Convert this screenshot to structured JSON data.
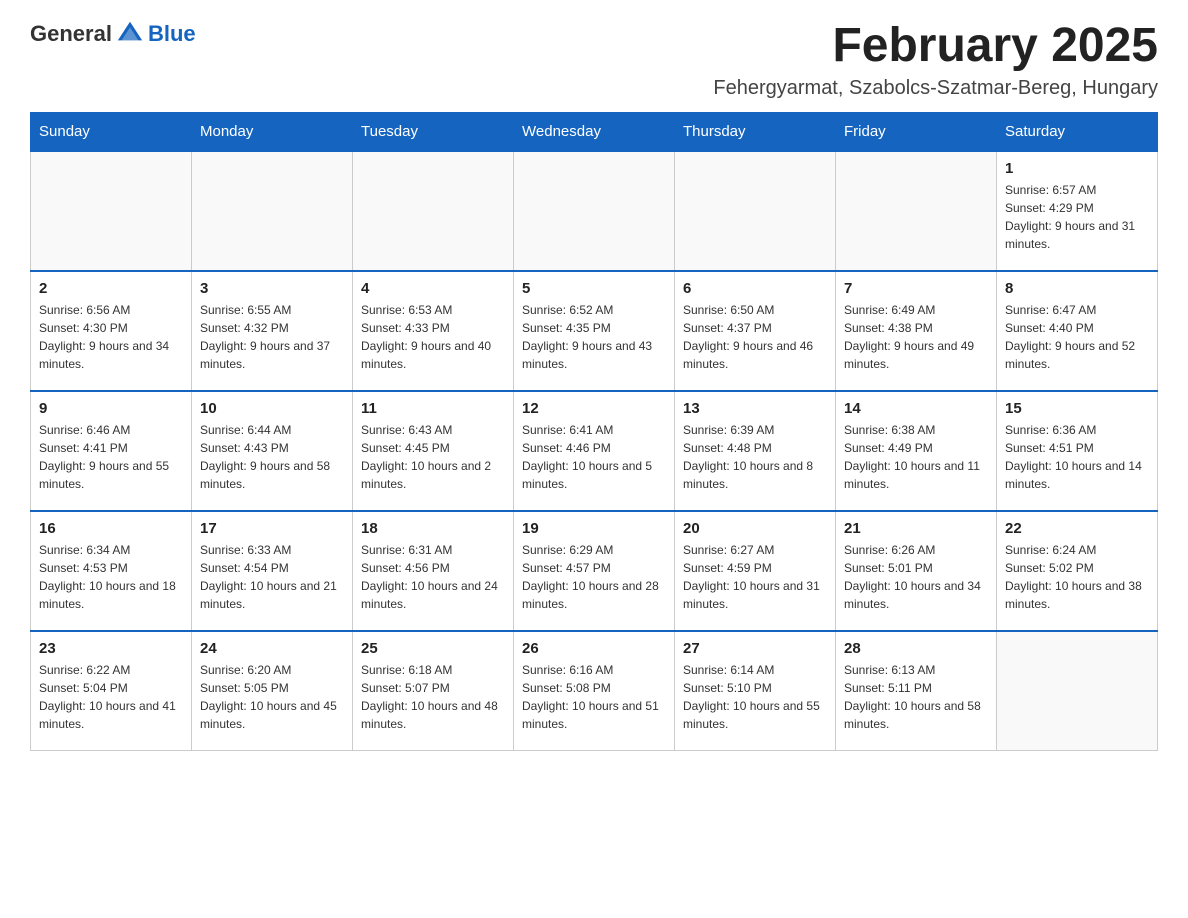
{
  "logo": {
    "text_general": "General",
    "text_blue": "Blue"
  },
  "header": {
    "month_title": "February 2025",
    "location": "Fehergyarmat, Szabolcs-Szatmar-Bereg, Hungary"
  },
  "weekdays": [
    "Sunday",
    "Monday",
    "Tuesday",
    "Wednesday",
    "Thursday",
    "Friday",
    "Saturday"
  ],
  "rows": [
    [
      {
        "day": "",
        "sunrise": "",
        "sunset": "",
        "daylight": ""
      },
      {
        "day": "",
        "sunrise": "",
        "sunset": "",
        "daylight": ""
      },
      {
        "day": "",
        "sunrise": "",
        "sunset": "",
        "daylight": ""
      },
      {
        "day": "",
        "sunrise": "",
        "sunset": "",
        "daylight": ""
      },
      {
        "day": "",
        "sunrise": "",
        "sunset": "",
        "daylight": ""
      },
      {
        "day": "",
        "sunrise": "",
        "sunset": "",
        "daylight": ""
      },
      {
        "day": "1",
        "sunrise": "Sunrise: 6:57 AM",
        "sunset": "Sunset: 4:29 PM",
        "daylight": "Daylight: 9 hours and 31 minutes."
      }
    ],
    [
      {
        "day": "2",
        "sunrise": "Sunrise: 6:56 AM",
        "sunset": "Sunset: 4:30 PM",
        "daylight": "Daylight: 9 hours and 34 minutes."
      },
      {
        "day": "3",
        "sunrise": "Sunrise: 6:55 AM",
        "sunset": "Sunset: 4:32 PM",
        "daylight": "Daylight: 9 hours and 37 minutes."
      },
      {
        "day": "4",
        "sunrise": "Sunrise: 6:53 AM",
        "sunset": "Sunset: 4:33 PM",
        "daylight": "Daylight: 9 hours and 40 minutes."
      },
      {
        "day": "5",
        "sunrise": "Sunrise: 6:52 AM",
        "sunset": "Sunset: 4:35 PM",
        "daylight": "Daylight: 9 hours and 43 minutes."
      },
      {
        "day": "6",
        "sunrise": "Sunrise: 6:50 AM",
        "sunset": "Sunset: 4:37 PM",
        "daylight": "Daylight: 9 hours and 46 minutes."
      },
      {
        "day": "7",
        "sunrise": "Sunrise: 6:49 AM",
        "sunset": "Sunset: 4:38 PM",
        "daylight": "Daylight: 9 hours and 49 minutes."
      },
      {
        "day": "8",
        "sunrise": "Sunrise: 6:47 AM",
        "sunset": "Sunset: 4:40 PM",
        "daylight": "Daylight: 9 hours and 52 minutes."
      }
    ],
    [
      {
        "day": "9",
        "sunrise": "Sunrise: 6:46 AM",
        "sunset": "Sunset: 4:41 PM",
        "daylight": "Daylight: 9 hours and 55 minutes."
      },
      {
        "day": "10",
        "sunrise": "Sunrise: 6:44 AM",
        "sunset": "Sunset: 4:43 PM",
        "daylight": "Daylight: 9 hours and 58 minutes."
      },
      {
        "day": "11",
        "sunrise": "Sunrise: 6:43 AM",
        "sunset": "Sunset: 4:45 PM",
        "daylight": "Daylight: 10 hours and 2 minutes."
      },
      {
        "day": "12",
        "sunrise": "Sunrise: 6:41 AM",
        "sunset": "Sunset: 4:46 PM",
        "daylight": "Daylight: 10 hours and 5 minutes."
      },
      {
        "day": "13",
        "sunrise": "Sunrise: 6:39 AM",
        "sunset": "Sunset: 4:48 PM",
        "daylight": "Daylight: 10 hours and 8 minutes."
      },
      {
        "day": "14",
        "sunrise": "Sunrise: 6:38 AM",
        "sunset": "Sunset: 4:49 PM",
        "daylight": "Daylight: 10 hours and 11 minutes."
      },
      {
        "day": "15",
        "sunrise": "Sunrise: 6:36 AM",
        "sunset": "Sunset: 4:51 PM",
        "daylight": "Daylight: 10 hours and 14 minutes."
      }
    ],
    [
      {
        "day": "16",
        "sunrise": "Sunrise: 6:34 AM",
        "sunset": "Sunset: 4:53 PM",
        "daylight": "Daylight: 10 hours and 18 minutes."
      },
      {
        "day": "17",
        "sunrise": "Sunrise: 6:33 AM",
        "sunset": "Sunset: 4:54 PM",
        "daylight": "Daylight: 10 hours and 21 minutes."
      },
      {
        "day": "18",
        "sunrise": "Sunrise: 6:31 AM",
        "sunset": "Sunset: 4:56 PM",
        "daylight": "Daylight: 10 hours and 24 minutes."
      },
      {
        "day": "19",
        "sunrise": "Sunrise: 6:29 AM",
        "sunset": "Sunset: 4:57 PM",
        "daylight": "Daylight: 10 hours and 28 minutes."
      },
      {
        "day": "20",
        "sunrise": "Sunrise: 6:27 AM",
        "sunset": "Sunset: 4:59 PM",
        "daylight": "Daylight: 10 hours and 31 minutes."
      },
      {
        "day": "21",
        "sunrise": "Sunrise: 6:26 AM",
        "sunset": "Sunset: 5:01 PM",
        "daylight": "Daylight: 10 hours and 34 minutes."
      },
      {
        "day": "22",
        "sunrise": "Sunrise: 6:24 AM",
        "sunset": "Sunset: 5:02 PM",
        "daylight": "Daylight: 10 hours and 38 minutes."
      }
    ],
    [
      {
        "day": "23",
        "sunrise": "Sunrise: 6:22 AM",
        "sunset": "Sunset: 5:04 PM",
        "daylight": "Daylight: 10 hours and 41 minutes."
      },
      {
        "day": "24",
        "sunrise": "Sunrise: 6:20 AM",
        "sunset": "Sunset: 5:05 PM",
        "daylight": "Daylight: 10 hours and 45 minutes."
      },
      {
        "day": "25",
        "sunrise": "Sunrise: 6:18 AM",
        "sunset": "Sunset: 5:07 PM",
        "daylight": "Daylight: 10 hours and 48 minutes."
      },
      {
        "day": "26",
        "sunrise": "Sunrise: 6:16 AM",
        "sunset": "Sunset: 5:08 PM",
        "daylight": "Daylight: 10 hours and 51 minutes."
      },
      {
        "day": "27",
        "sunrise": "Sunrise: 6:14 AM",
        "sunset": "Sunset: 5:10 PM",
        "daylight": "Daylight: 10 hours and 55 minutes."
      },
      {
        "day": "28",
        "sunrise": "Sunrise: 6:13 AM",
        "sunset": "Sunset: 5:11 PM",
        "daylight": "Daylight: 10 hours and 58 minutes."
      },
      {
        "day": "",
        "sunrise": "",
        "sunset": "",
        "daylight": ""
      }
    ]
  ]
}
